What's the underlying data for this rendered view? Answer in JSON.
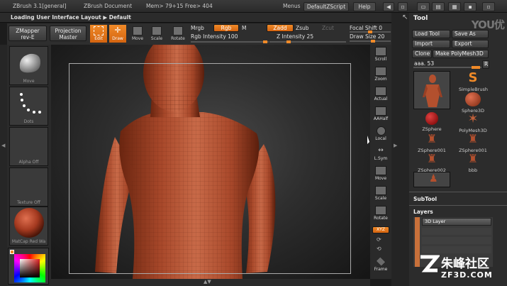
{
  "app": {
    "title": "ZBrush 3.1[general]",
    "document": "ZBrush Document",
    "mem": "Mem> 79+15 Free> 404",
    "menus": "Menus",
    "script": "DefaultZScript",
    "help": "Help"
  },
  "status": {
    "text": "Loading User Interface Layout ▶ Default"
  },
  "shelf": {
    "zmapper": [
      "ZMapper",
      "rev-E"
    ],
    "projection": [
      "Projection",
      "Master"
    ],
    "edit": "Edit",
    "draw": "Draw",
    "move": "Move",
    "scale": "Scale",
    "rotate": "Rotate",
    "mrgb": "Mrgb",
    "rgb": "Rgb",
    "m": "M",
    "rgb_intensity": "Rgb Intensity 100",
    "zadd": "Zadd",
    "zsub": "Zsub",
    "zcut": "Zcut",
    "z_intensity": "Z Intensity 25",
    "focal_shift": "Focal Shift 0",
    "draw_size": "Draw Size 20"
  },
  "left_panel": {
    "move": "Move",
    "dots": "Dots",
    "alpha": "Alpha Off",
    "texture": "Texture Off",
    "material": "MatCap Red Wa"
  },
  "right_shelf": [
    "Scroll",
    "Zoom",
    "Actual",
    "AAHalf",
    "Local",
    "L.Sym",
    "Move",
    "Scale",
    "Rotate",
    "XYZ",
    "Frame"
  ],
  "tool": {
    "title": "Tool",
    "load": "Load Tool",
    "save": "Save As",
    "import": "Import",
    "export": "Export",
    "clone": "Clone",
    "polymesh": "Make PolyMesh3D",
    "current": "aaa. 53",
    "r": "R",
    "items": [
      "SimpleBrush",
      "Sphere3D",
      "ZSphere",
      "PolyMesh3D",
      "ZSphere001",
      "ZSphere001",
      "ZSphere002",
      "bbb"
    ],
    "subtool": "SubTool",
    "layers": "Layers",
    "layer_name": "3D Layer"
  },
  "watermark": {
    "brand": "朱峰社区",
    "site": "ZF3D.COM"
  },
  "corner_mark": "YOU优",
  "colors": {
    "accent": "#f08a28",
    "skin": "#b3502e"
  }
}
